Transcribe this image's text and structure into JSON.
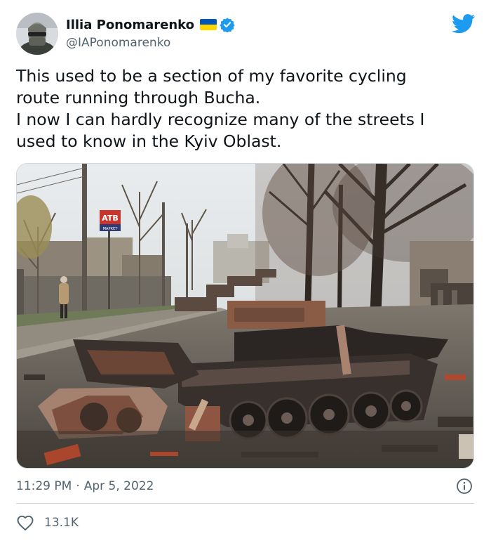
{
  "author": {
    "name": "Illia Ponomarenko",
    "handle": "@IAPonomarenko",
    "flag_colors": [
      "#0057b7",
      "#ffd700"
    ],
    "verified_color": "#1d9bf0"
  },
  "brand": {
    "icon": "twitter-bird-icon",
    "color": "#1d9bf0"
  },
  "tweet": {
    "lines": [
      "This used to be a section of my favorite cycling",
      "route running through Bucha.",
      "I now I can hardly recognize many of the streets I",
      "used to know in the Kyiv Oblast."
    ],
    "time": "11:29 PM",
    "separator": "·",
    "date": "Apr 5, 2022"
  },
  "photo": {
    "sign_text": "ATB",
    "sign_subtext": "МАРКЕТ"
  },
  "stats": {
    "likes": "13.1K"
  },
  "icons": {
    "info": "info-icon",
    "like": "heart-icon"
  }
}
